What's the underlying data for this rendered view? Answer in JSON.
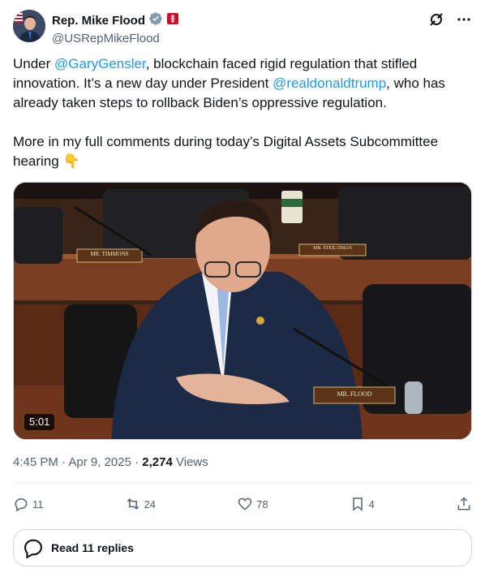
{
  "author": {
    "display_name": "Rep. Mike Flood",
    "handle": "@USRepMikeFlood"
  },
  "tweet": {
    "text_1": "Under ",
    "mention_1": "@GaryGensler",
    "text_2": ", blockchain faced rigid regulation that stifled innovation. It’s a new day under President ",
    "mention_2": "@realdonaldtrump",
    "text_3": ", who has already taken steps to rollback Biden’s oppressive regulation.\n\nMore in my full comments during today’s Digital Assets Subcommittee hearing ",
    "emoji": "👇"
  },
  "media": {
    "duration": "5:01",
    "nameplate_1": "MR. TIMMONS",
    "nameplate_2": "MR. STEIL/ZMAN",
    "nameplate_3": "MR. FLOOD"
  },
  "meta": {
    "time": "4:45 PM",
    "separator": " · ",
    "date": "Apr 9, 2025",
    "views_count": "2,274",
    "views_label": " Views"
  },
  "actions": {
    "replies": "11",
    "reposts": "24",
    "likes": "78",
    "bookmarks": "4"
  },
  "read_replies_label": "Read 11 replies",
  "colors": {
    "accent": "#1d9bf0",
    "verified_gray": "#829aab",
    "text_secondary": "#536471"
  }
}
